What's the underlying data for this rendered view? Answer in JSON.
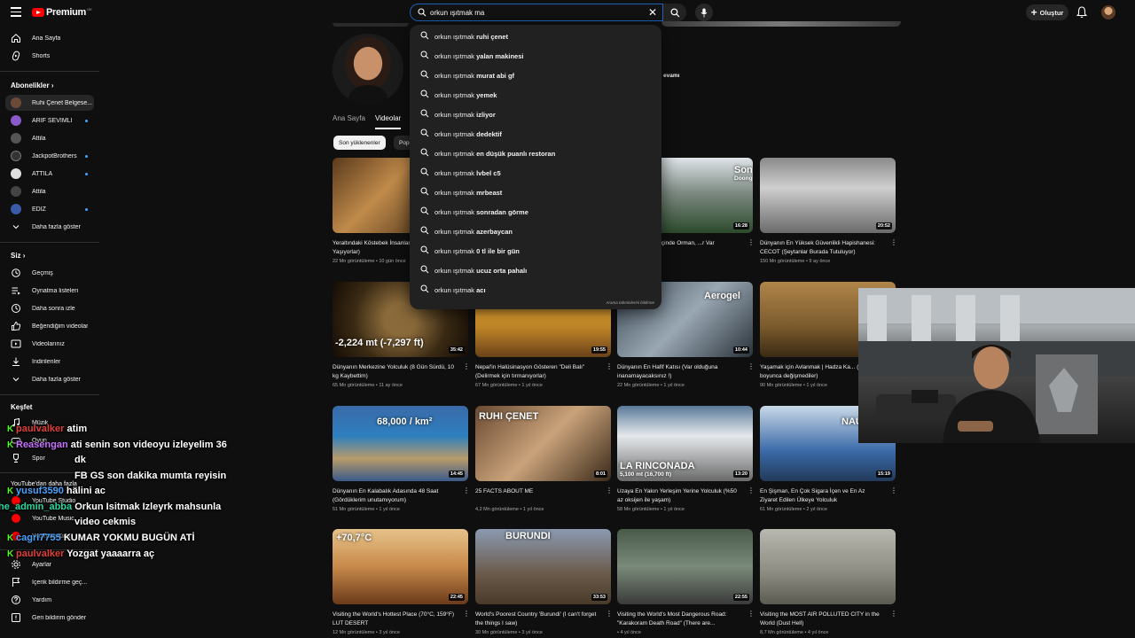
{
  "header": {
    "logo_text": "Premium",
    "logo_country": "GE",
    "search_value": "orkun ışıtmak ma",
    "create_label": "Oluştur"
  },
  "sidebar": {
    "main": [
      {
        "label": "Ana Sayfa",
        "icon": "home-icon"
      },
      {
        "label": "Shorts",
        "icon": "shorts-icon"
      }
    ],
    "subs_heading": "Abonelikler",
    "subs": [
      {
        "label": "Ruhi Çenet Belgese...",
        "color": "#6b4a3a",
        "dot": false
      },
      {
        "label": "ARİF SEVİMLİ",
        "color": "#8a5ac8",
        "dot": true
      },
      {
        "label": "Attila",
        "color": "#555555",
        "dot": false
      },
      {
        "label": "JackpotBrothers",
        "color": "#333333",
        "dot": true
      },
      {
        "label": "ATTILA",
        "color": "#e0e0e0",
        "dot": true
      },
      {
        "label": "Attila",
        "color": "#444444",
        "dot": false
      },
      {
        "label": "EDIZ",
        "color": "#3a5aa8",
        "dot": true
      }
    ],
    "subs_more": "Daha fazla göster",
    "you_heading": "Siz",
    "you": [
      {
        "label": "Geçmiş",
        "icon": "history-icon"
      },
      {
        "label": "Oynatma listeleri",
        "icon": "playlist-icon"
      },
      {
        "label": "Daha sonra izle",
        "icon": "clock-icon"
      },
      {
        "label": "Beğendiğim videolar",
        "icon": "like-icon"
      },
      {
        "label": "Videolarınız",
        "icon": "video-icon"
      },
      {
        "label": "İndirilenler",
        "icon": "download-icon"
      }
    ],
    "you_more": "Daha fazla göster",
    "explore_heading": "Keşfet",
    "explore": [
      {
        "label": "Müzik"
      },
      {
        "label": "Oyun"
      },
      {
        "label": "Spor"
      }
    ],
    "more_from": "YouTube'dan daha fazla",
    "more_items": [
      {
        "label": "YouTube Studio"
      },
      {
        "label": "YouTube Music"
      },
      {
        "label": "YouTube Kids"
      }
    ],
    "bottom": [
      {
        "label": "Ayarlar",
        "icon": "settings-icon"
      },
      {
        "label": "İçerik bildirme geç...",
        "icon": "flag-icon"
      },
      {
        "label": "Yardım",
        "icon": "help-icon"
      },
      {
        "label": "Geri bildirim gönder",
        "icon": "feedback-icon"
      }
    ]
  },
  "channel": {
    "extra_text": "evamı",
    "tabs": [
      "Ana Sayfa",
      "Videolar"
    ],
    "chips": [
      "Son yüklenenler",
      "Pop"
    ]
  },
  "suggestions": {
    "typed": "orkun ışıtmak",
    "items": [
      "ruhi çenet",
      "yalan makinesi",
      "murat abi gf",
      "yemek",
      "izliyor",
      "dedektif",
      "en düşük puanlı restoran",
      "lvbel c5",
      "mrbeast",
      "sonradan görme",
      "azerbaycan",
      "0 tl ile bir gün",
      "ucuz orta pahalı",
      "acı"
    ],
    "report_label": "Arama tahminlerini bildirme"
  },
  "videos": [
    {
      "title": "Yeraltındaki Köstebek İnsanlar (Güneşsiz Yaşıyorlar)",
      "meta": "22 Mn görüntüleme • 10 gün önce",
      "duration": "",
      "overlay": ""
    },
    {
      "title": "",
      "meta": "",
      "duration": "",
      "overlay": ""
    },
    {
      "title": "...yük Mağarası: İçinde Orman, ...r Var",
      "meta": "• 8 ay önce",
      "duration": "16:28",
      "overlay": "Son\nDoong"
    },
    {
      "title": "Dünyanın En Yüksek Güvenlikli Hapishanesi: CECOT (Şeytanlar Burada Tutuluyor)",
      "meta": "150 Mn görüntüleme • 9 ay önce",
      "duration": "20:52",
      "overlay": ""
    },
    {
      "title": "Dünyanın Merkezine Yolculuk (8 Gün Sürdü, 10 kg Kaybettim)",
      "meta": "65 Mn görüntüleme • 11 ay önce",
      "duration": "35:42",
      "overlay": "-2,224 mt (-7,297 ft)"
    },
    {
      "title": "Nepal'in Halüsinasyon Gösteren \"Deli Balı\" (Delirmek için tırmanıyorlar)",
      "meta": "67 Mn görüntüleme • 1 yıl önce",
      "duration": "19:55",
      "overlay": ""
    },
    {
      "title": "Dünyanın En Hafif Katısı (Var olduğuna inanamayacaksınız !)",
      "meta": "22 Mn görüntüleme • 1 yıl önce",
      "duration": "10:44",
      "overlay": "Aerogel"
    },
    {
      "title": "Yaşamak için Avlanmak | Hadza Ka... (50.000 yıl boyunca değişmediler)",
      "meta": "90 Mn görüntüleme • 1 yıl önce",
      "duration": "",
      "overlay": ""
    },
    {
      "title": "Dünyanın En Kalabalık Adasında 48 Saat (Gördüklerim unutamıyorum)",
      "meta": "51 Mn görüntüleme • 1 yıl önce",
      "duration": "14:45",
      "overlay": "68,000 / km²"
    },
    {
      "title": "25 FACTS ABOUT ME",
      "meta": "4,2 Mn görüntüleme • 1 yıl önce",
      "duration": "8:01",
      "overlay": "RUHI ÇENET"
    },
    {
      "title": "Uzaya En Yakın Yerleşim Yerine Yolculuk (%50 az oksijen ile yaşam)",
      "meta": "58 Mn görüntüleme • 1 yıl önce",
      "duration": "13:20",
      "overlay": "LA RINCONADA\n5,100 mt (16,700 ft)"
    },
    {
      "title": "En Şişman, En Çok Sigara İçen ve En Az Ziyaret Edilen Ülkeye Yolculuk",
      "meta": "61 Mn görüntüleme • 2 yıl önce",
      "duration": "15:19",
      "overlay": "NAU"
    },
    {
      "title": "Visiting the World's Hottest Place (70°C, 159°F) LUT DESERT",
      "meta": "12 Mn görüntüleme • 3 yıl önce",
      "duration": "22:45",
      "overlay": "+70,7°C"
    },
    {
      "title": "World's Poorest Country 'Burundi' (I can't forget the things I saw)",
      "meta": "30 Mn görüntüleme • 3 yıl önce",
      "duration": "33:53",
      "overlay": "BURUNDI"
    },
    {
      "title": "Visiting the World's Most Dangerous Road: \"Karakoram Death Road\" (There are...",
      "meta": "• 4 yıl önce",
      "duration": "22:55",
      "overlay": ""
    },
    {
      "title": "Visiting the MOST AIR POLLUTED CITY in the World (Dust Hell)",
      "meta": "8,7 Mn görüntüleme • 4 yıl önce",
      "duration": "",
      "overlay": ""
    }
  ],
  "chat": [
    {
      "user": "paulvalker",
      "color": "#e0403a",
      "msg": "atim"
    },
    {
      "user": "Reasengan",
      "color": "#c873ff",
      "msg": "ati senin son videoyu izleyelim 36"
    },
    {
      "user": "",
      "color": "",
      "msg": "dk"
    },
    {
      "user": "",
      "color": "",
      "msg": "FB GS son dakika mumta reyisin"
    },
    {
      "user": "yusuf3590",
      "color": "#4aa3ff",
      "msg": "hälini ac"
    },
    {
      "user": "he_admin_abba",
      "color": "#28d7a0",
      "msg": "Orkun Isitmak Izleyrk mahsunla"
    },
    {
      "user": "",
      "color": "",
      "msg": "video cekmis"
    },
    {
      "user": "cagri7755",
      "color": "#4aa3ff",
      "msg": "KUMAR YOKMU BUGÜN ATİ"
    },
    {
      "user": "paulvalker",
      "color": "#e0403a",
      "msg": "Yozgat yaaaarra aç"
    }
  ]
}
